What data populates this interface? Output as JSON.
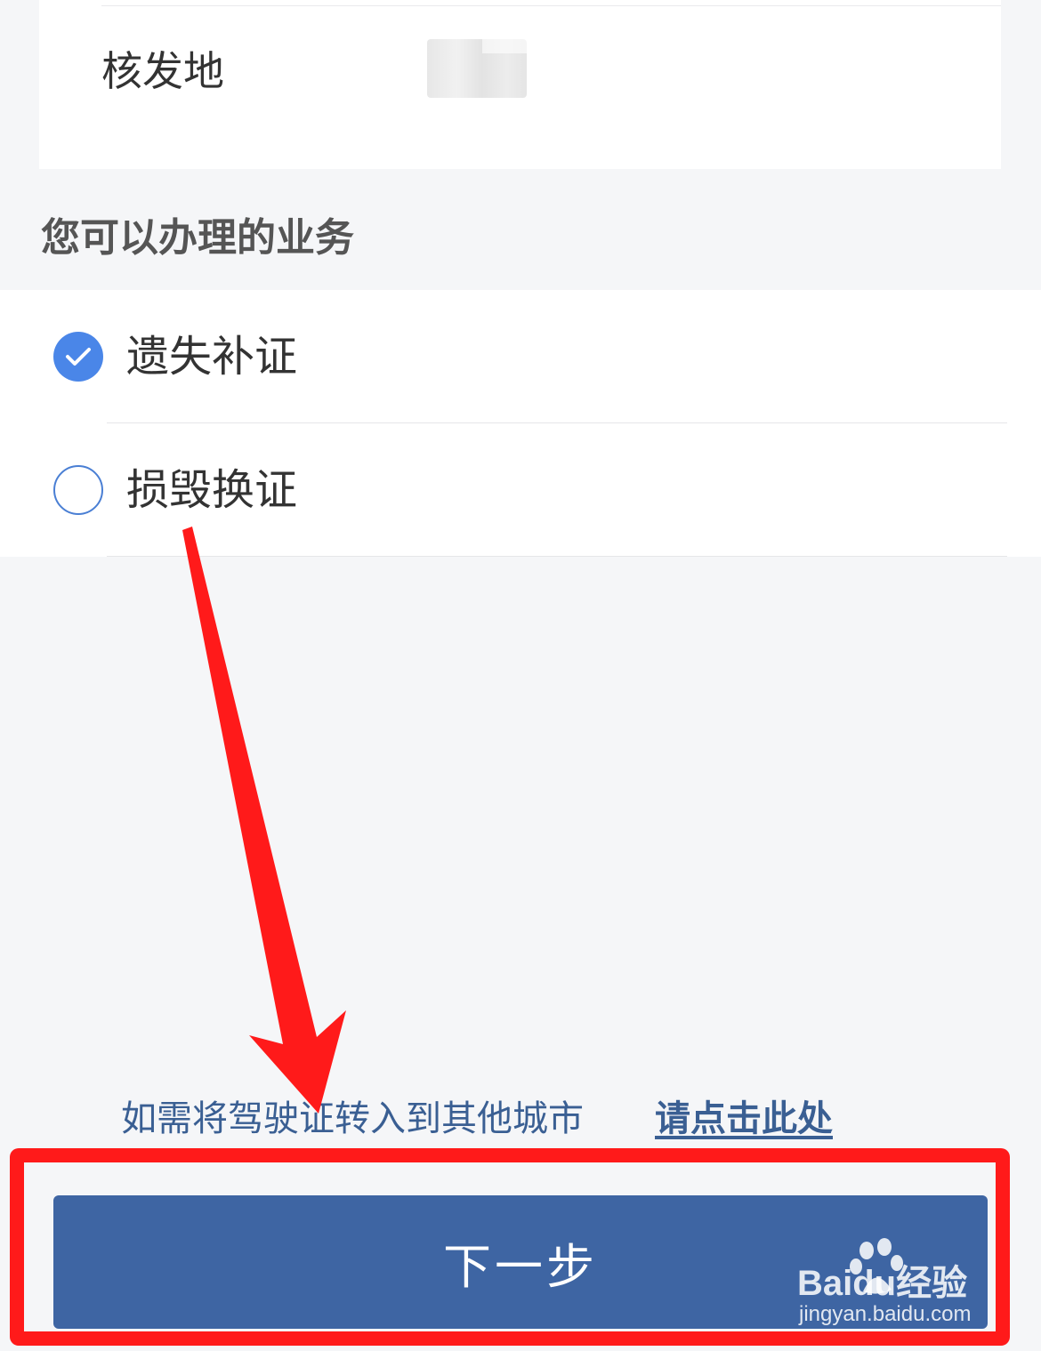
{
  "info": {
    "issue_place_label": "核发地"
  },
  "services": {
    "title": "您可以办理的业务",
    "options": [
      {
        "label": "遗失补证",
        "checked": true
      },
      {
        "label": "损毁换证",
        "checked": false
      }
    ]
  },
  "transfer": {
    "text": "如需将驾驶证转入到其他城市",
    "link_label": "请点击此处"
  },
  "next_button": {
    "label": "下一步"
  },
  "watermark": {
    "brand": "Baidu经验",
    "url": "jingyan.baidu.com"
  },
  "colors": {
    "accent": "#4a86e8",
    "button": "#3e65a3",
    "link": "#3a5f93",
    "annotation": "#ff1a1a",
    "background": "#f5f6f8"
  }
}
